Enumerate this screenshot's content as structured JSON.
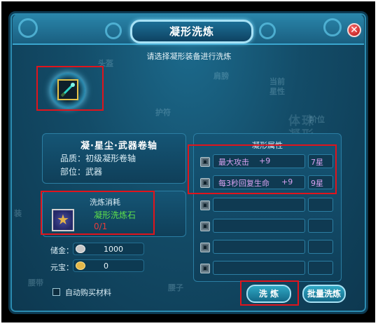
{
  "window": {
    "title": "凝形洗炼",
    "close_label": "✕"
  },
  "instruction": "请选择凝形装备进行洗炼",
  "item": {
    "name": "凝·星尘·武器卷轴",
    "quality_label": "品质：",
    "quality_value": "初级凝形卷轴",
    "part_label": "部位：",
    "part_value": "武器"
  },
  "cost": {
    "title": "洗炼消耗",
    "material_name": "凝形洗炼石",
    "material_count": "0/1"
  },
  "currency": {
    "silver_label": "储金：",
    "silver_value": "1000",
    "gold_label": "元宝：",
    "gold_value": "0"
  },
  "auto_buy_label": "自动购买材料",
  "attributes": {
    "title": "凝形属性",
    "rows": [
      {
        "name": "最大攻击",
        "value": "+9",
        "stars": "7星"
      },
      {
        "name": "每3秒回复生命",
        "value": "+9",
        "stars": "9星"
      },
      {
        "name": "",
        "value": "",
        "stars": ""
      },
      {
        "name": "",
        "value": "",
        "stars": ""
      },
      {
        "name": "",
        "value": "",
        "stars": ""
      },
      {
        "name": "",
        "value": "",
        "stars": ""
      }
    ]
  },
  "buttons": {
    "refine": "洗 炼",
    "batch_refine": "批量洗炼"
  },
  "icons": {
    "item": "scroll-weapon-icon",
    "material": "star-stone-icon",
    "silver": "silver-ingot-icon",
    "gold": "gold-ingot-icon",
    "lock": "lock-icon",
    "close": "close-icon"
  },
  "background_ghost_text": {
    "head": "头盔",
    "shoulder": "肩膀",
    "guard": "护符",
    "current_star": "当前",
    "star_label": "星性",
    "pearl_row": "体珠",
    "condense": "凝形",
    "position": "阶位",
    "waist": "腰子",
    "left_edge": "装",
    "bottom_left": "腰带"
  },
  "colors": {
    "panel": "#134c68",
    "highlight_box": "#e0141c",
    "attribute_text": "#d8a2f0",
    "material_text": "#5ee04b",
    "count_text": "#e33c3c"
  }
}
